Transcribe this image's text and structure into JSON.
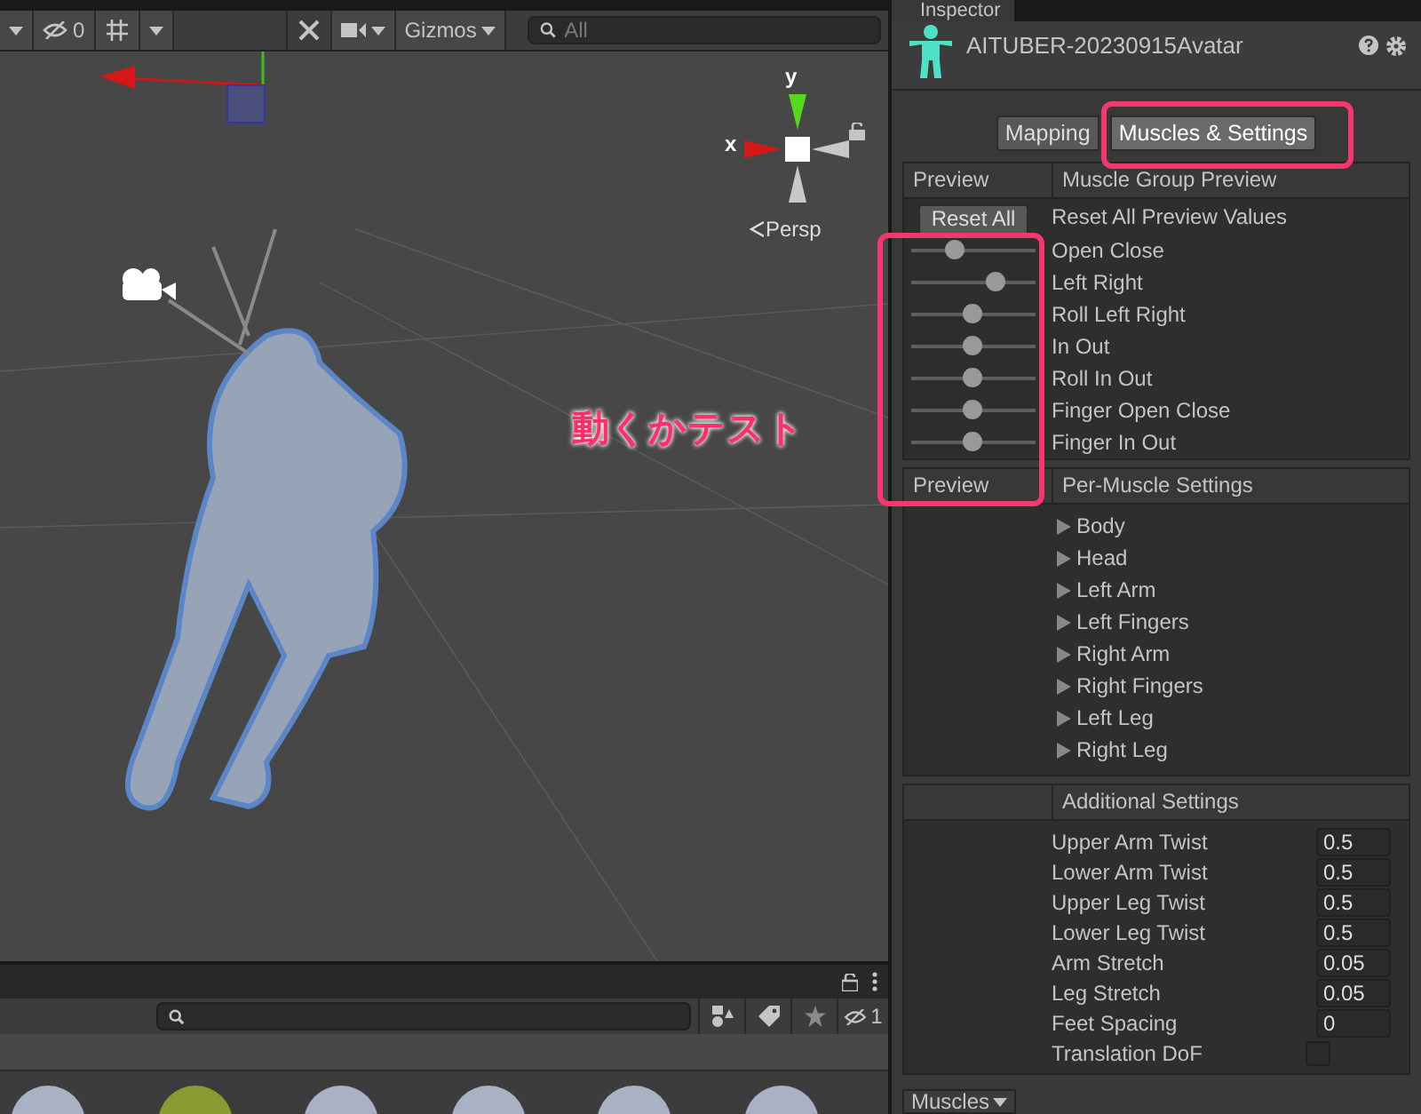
{
  "scene_toolbar": {
    "hidden_count": "0",
    "gizmos_label": "Gizmos",
    "search_placeholder": "All"
  },
  "scene": {
    "axis_x_label": "x",
    "axis_y_label": "y",
    "projection": "Persp"
  },
  "annotation": {
    "text": "動くかテスト"
  },
  "inspector": {
    "tab": "Inspector",
    "asset_name": "AITUBER-20230915Avatar",
    "tabs": [
      {
        "label": "Mapping",
        "selected": false
      },
      {
        "label": "Muscles & Settings",
        "selected": true
      }
    ],
    "muscle_group": {
      "column_1": "Preview",
      "column_2": "Muscle Group Preview",
      "reset_button": "Reset All",
      "reset_label": "Reset All Preview Values",
      "sliders": [
        {
          "label": "Open Close",
          "level": 0.35
        },
        {
          "label": "Left Right",
          "level": 0.68
        },
        {
          "label": "Roll Left Right",
          "level": 0.5
        },
        {
          "label": "In Out",
          "level": 0.5
        },
        {
          "label": "Roll In Out",
          "level": 0.5
        },
        {
          "label": "Finger Open Close",
          "level": 0.5
        },
        {
          "label": "Finger In Out",
          "level": 0.5
        }
      ]
    },
    "per_muscle": {
      "column_1": "Preview",
      "column_2": "Per-Muscle Settings",
      "groups": [
        {
          "label": "Body",
          "expanded": false
        },
        {
          "label": "Head",
          "expanded": false
        },
        {
          "label": "Left Arm",
          "expanded": false
        },
        {
          "label": "Left Fingers",
          "expanded": false
        },
        {
          "label": "Right Arm",
          "expanded": false
        },
        {
          "label": "Right Fingers",
          "expanded": false
        },
        {
          "label": "Left Leg",
          "expanded": false
        },
        {
          "label": "Right Leg",
          "expanded": false
        }
      ]
    },
    "additional": {
      "title": "Additional Settings",
      "fields": [
        {
          "kind": "number",
          "label": "Upper Arm Twist",
          "value": "0.5"
        },
        {
          "kind": "number",
          "label": "Lower Arm Twist",
          "value": "0.5"
        },
        {
          "kind": "number",
          "label": "Upper Leg Twist",
          "value": "0.5"
        },
        {
          "kind": "number",
          "label": "Lower Leg Twist",
          "value": "0.5"
        },
        {
          "kind": "number",
          "label": "Arm Stretch",
          "value": "0.05"
        },
        {
          "kind": "number",
          "label": "Leg Stretch",
          "value": "0.05"
        },
        {
          "kind": "number",
          "label": "Feet Spacing",
          "value": "0"
        },
        {
          "kind": "checkbox",
          "label": "Translation DoF",
          "checked": false
        }
      ]
    },
    "footer_dropdown": "Muscles"
  },
  "project_panel": {
    "hidden_count": "1"
  }
}
